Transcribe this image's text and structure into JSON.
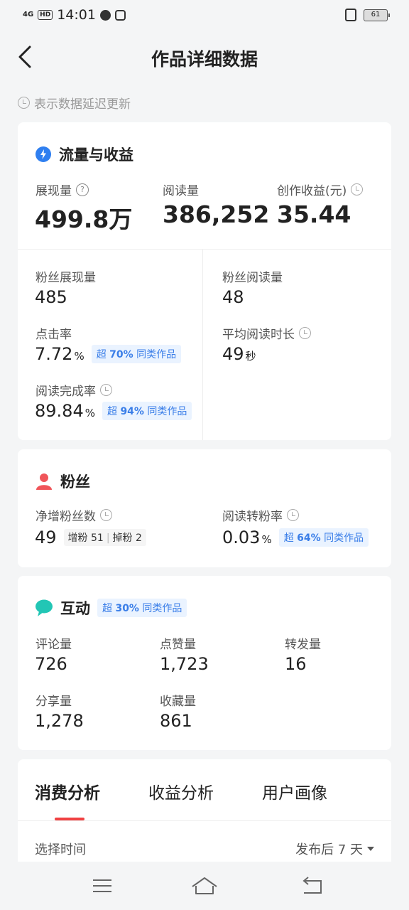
{
  "status": {
    "network": "4G",
    "hd": "HD",
    "time": "14:01",
    "battery": "61"
  },
  "header": {
    "title": "作品详细数据"
  },
  "notice": "表示数据延迟更新",
  "traffic": {
    "title": "流量与收益",
    "impressions_label": "展现量",
    "impressions_value": "499.8万",
    "reads_label": "阅读量",
    "reads_value": "386,252",
    "earnings_label": "创作收益(元)",
    "earnings_value": "35.44",
    "fan_impr_label": "粉丝展现量",
    "fan_impr_value": "485",
    "fan_read_label": "粉丝阅读量",
    "fan_read_value": "48",
    "ctr_label": "点击率",
    "ctr_value": "7.72",
    "ctr_unit": "%",
    "ctr_badge_pre": "超",
    "ctr_badge_pct": "70%",
    "ctr_badge_post": "同类作品",
    "avg_time_label": "平均阅读时长",
    "avg_time_value": "49",
    "avg_time_unit": "秒",
    "completion_label": "阅读完成率",
    "completion_value": "89.84",
    "completion_unit": "%",
    "completion_badge_pre": "超",
    "completion_badge_pct": "94%",
    "completion_badge_post": "同类作品"
  },
  "fans": {
    "title": "粉丝",
    "net_label": "净增粉丝数",
    "net_value": "49",
    "gain_label": "增粉",
    "gain_value": "51",
    "lose_label": "掉粉",
    "lose_value": "2",
    "conv_label": "阅读转粉率",
    "conv_value": "0.03",
    "conv_unit": "%",
    "conv_badge_pre": "超",
    "conv_badge_pct": "64%",
    "conv_badge_post": "同类作品"
  },
  "interaction": {
    "title": "互动",
    "badge_pre": "超",
    "badge_pct": "30%",
    "badge_post": "同类作品",
    "comments_label": "评论量",
    "comments_value": "726",
    "likes_label": "点赞量",
    "likes_value": "1,723",
    "reposts_label": "转发量",
    "reposts_value": "16",
    "shares_label": "分享量",
    "shares_value": "1,278",
    "favorites_label": "收藏量",
    "favorites_value": "861"
  },
  "tabs": {
    "consumption": "消费分析",
    "earnings": "收益分析",
    "portrait": "用户画像"
  },
  "time_filter": {
    "label": "选择时间",
    "value": "发布后 7 天"
  },
  "colors": {
    "accent": "#f04142",
    "badge_bg": "#eaf3ff",
    "badge_text": "#3a7ee8",
    "traffic_icon": "#2f7ff0",
    "fans_icon": "#f0555a",
    "interaction_icon": "#22c6b5"
  }
}
